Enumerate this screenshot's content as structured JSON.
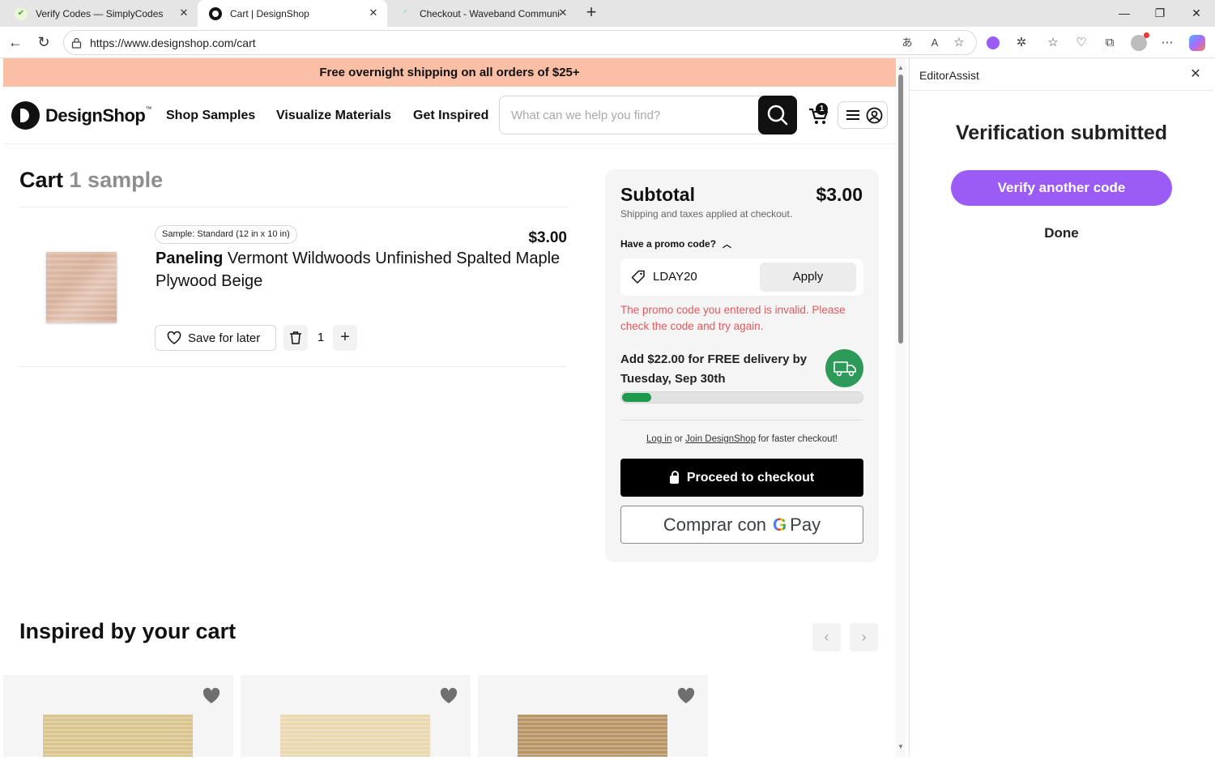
{
  "browser": {
    "tabs": [
      {
        "title": "Verify Codes — SimplyCodes",
        "active": false
      },
      {
        "title": "Cart | DesignShop",
        "active": true
      },
      {
        "title": "Checkout - Waveband Communic",
        "active": false
      }
    ],
    "url": "https://www.designshop.com/cart"
  },
  "banner": {
    "text": "Free overnight shipping on all orders of $25+"
  },
  "header": {
    "logo_text": "DesignShop",
    "logo_tm": "™",
    "nav": [
      "Shop Samples",
      "Visualize Materials",
      "Get Inspired"
    ],
    "search_placeholder": "What can we help you find?",
    "cart_count": "1"
  },
  "cart": {
    "title": "Cart",
    "count_label": "1 sample",
    "item": {
      "chip": "Sample: Standard (12 in x 10 in)",
      "price": "$3.00",
      "category": "Paneling",
      "name": "Vermont Wildwoods Unfinished Spalted Maple Plywood Beige",
      "save_label": "Save for later",
      "quantity": "1"
    }
  },
  "summary": {
    "subtotal_label": "Subtotal",
    "subtotal_value": "$3.00",
    "note": "Shipping and taxes applied at checkout.",
    "promo_toggle": "Have a promo code?",
    "promo_value": "LDAY20",
    "apply_label": "Apply",
    "promo_error": "The promo code you entered is invalid. Please check the code and try again.",
    "delivery_msg": "Add $22.00 for FREE delivery by Tuesday, Sep 30th",
    "progress_fraction": 0.12,
    "login_link": "Log in",
    "login_or": "or",
    "join_link": "Join DesignShop",
    "login_suffix": "for faster checkout!",
    "checkout_label": "Proceed to checkout",
    "gpay_prefix": "Comprar con",
    "gpay_g": "G",
    "gpay_pay": "Pay",
    "colors": {
      "error": "#e4585b",
      "progress": "#1e9a4d",
      "truck_bg": "#2d9a5a"
    }
  },
  "inspired": {
    "title": "Inspired by your cart",
    "cards": [
      {
        "swatch": "#d9c48e"
      },
      {
        "swatch": "#ead9b0"
      },
      {
        "swatch": "#b99465"
      }
    ]
  },
  "panel": {
    "title": "EditorAssist",
    "heading": "Verification submitted",
    "verify_label": "Verify another code",
    "done_label": "Done",
    "accent": "#9b5cf6"
  }
}
